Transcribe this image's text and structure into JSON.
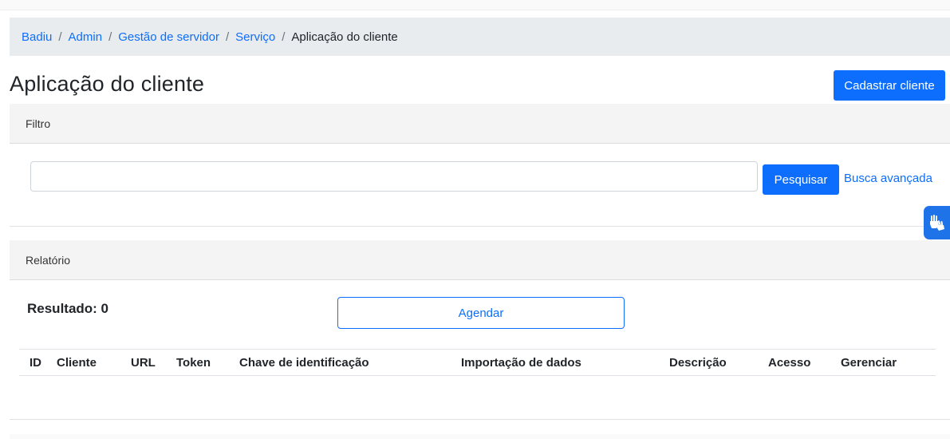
{
  "breadcrumb": {
    "items": [
      "Badiu",
      "Admin",
      "Gestão de servidor",
      "Serviço"
    ],
    "current": "Aplicação do cliente",
    "separator": "/"
  },
  "page": {
    "title": "Aplicação do cliente",
    "register_button": "Cadastrar cliente"
  },
  "filter": {
    "header": "Filtro",
    "search_value": "",
    "search_button": "Pesquisar",
    "advanced_link": "Busca avançada"
  },
  "report": {
    "header": "Relatório",
    "result_label": "Resultado: 0",
    "schedule_button": "Agendar",
    "columns": [
      "ID",
      "Cliente",
      "URL",
      "Token",
      "Chave de identificação",
      "Importação de dados",
      "Descrição",
      "Acesso",
      "Gerenciar"
    ]
  },
  "icons": {
    "accessibility": "sign-language-hands-icon"
  },
  "colors": {
    "primary": "#0d6efd",
    "breadcrumb_bg": "#e9ecef",
    "section_bg": "#f4f4f4",
    "widget": "#1e73e8"
  }
}
